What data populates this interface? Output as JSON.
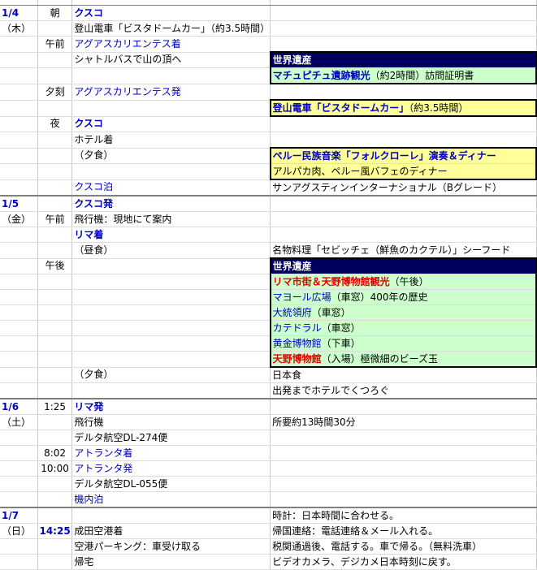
{
  "rows": [
    {
      "c0": "1/4",
      "c1": "朝",
      "c2": "クスコ",
      "c3": ""
    },
    {
      "c0": "（木）",
      "c1": "",
      "c2": "登山電車「ビスタドームカー」（約3.5時間）",
      "c3": ""
    },
    {
      "c0": "",
      "c1": "午前",
      "c2": "アグアスカリエンテス着",
      "c3": ""
    },
    {
      "c0": "",
      "c1": "",
      "c2": "シャトルバスで山の頂へ",
      "c3": "世界遺産"
    },
    {
      "c0": "",
      "c1": "",
      "c2": "",
      "c3a": "マチュピチュ遺跡観光",
      "c3b": "（約2時間）訪問証明書"
    },
    {
      "c0": "",
      "c1": "夕刻",
      "c2": "アグアスカリエンテス発",
      "c3": ""
    },
    {
      "c0": "",
      "c1": "",
      "c2": "",
      "c3a": "登山電車「ビスタドームカー」",
      "c3b": "（約3.5時間）"
    },
    {
      "c0": "",
      "c1": "夜",
      "c2": "クスコ",
      "c3": ""
    },
    {
      "c0": "",
      "c1": "",
      "c2": "ホテル着",
      "c3": ""
    },
    {
      "c0": "",
      "c1": "",
      "c2": "（夕食）",
      "c3": "ペルー民族音楽「フォルクローレ」演奏＆ディナー"
    },
    {
      "c0": "",
      "c1": "",
      "c2": "",
      "c3": "アルパカ肉、ペルー風バフェのディナー"
    },
    {
      "c0": "",
      "c1": "",
      "c2": "クスコ泊",
      "c3": "サンアグスティンインターナショナル（Bグレード）"
    },
    {
      "c0": "1/5",
      "c1": "",
      "c2": "クスコ発",
      "c3": ""
    },
    {
      "c0": "（金）",
      "c1": "午前",
      "c2": "飛行機：現地にて案内",
      "c3": ""
    },
    {
      "c0": "",
      "c1": "",
      "c2": "リマ着",
      "c3": ""
    },
    {
      "c0": "",
      "c1": "",
      "c2": "（昼食）",
      "c3": "名物料理「セビッチェ（鮮魚のカクテル）」シーフード"
    },
    {
      "c0": "",
      "c1": "午後",
      "c2": "",
      "c3": "世界遺産"
    },
    {
      "c0": "",
      "c1": "",
      "c2": "",
      "c3a": "リマ市街＆天野博物館観光",
      "c3b": "（午後）"
    },
    {
      "c0": "",
      "c1": "",
      "c2": "",
      "c3a": "マヨール広場",
      "c3b": "（車窓）400年の歴史"
    },
    {
      "c0": "",
      "c1": "",
      "c2": "",
      "c3a": "大統領府",
      "c3b": "（車窓）"
    },
    {
      "c0": "",
      "c1": "",
      "c2": "",
      "c3a": "カテドラル",
      "c3b": "（車窓）"
    },
    {
      "c0": "",
      "c1": "",
      "c2": "",
      "c3a": "黄金博物館",
      "c3b": "（下車）"
    },
    {
      "c0": "",
      "c1": "",
      "c2": "",
      "c3a": "天野博物館",
      "c3b": "（入場）極微細のビーズ玉"
    },
    {
      "c0": "",
      "c1": "",
      "c2": "（夕食）",
      "c3": "日本食"
    },
    {
      "c0": "",
      "c1": "",
      "c2": "",
      "c3": "出発までホテルでくつろぐ"
    },
    {
      "c0": "1/6",
      "c1": "1:25",
      "c2": "リマ発",
      "c3": ""
    },
    {
      "c0": "（土）",
      "c1": "",
      "c2": "飛行機",
      "c3": "所要約13時間30分"
    },
    {
      "c0": "",
      "c1": "",
      "c2": "デルタ航空DL-274便",
      "c3": ""
    },
    {
      "c0": "",
      "c1": "8:02",
      "c2": "アトランタ着",
      "c3": ""
    },
    {
      "c0": "",
      "c1": "10:00",
      "c2": "アトランタ発",
      "c3": ""
    },
    {
      "c0": "",
      "c1": "",
      "c2": "デルタ航空DL-055便",
      "c3": ""
    },
    {
      "c0": "",
      "c1": "",
      "c2": "機内泊",
      "c3": ""
    },
    {
      "c0": "1/7",
      "c1": "",
      "c2": "",
      "c3": "時計：日本時間に合わせる。"
    },
    {
      "c0": "（日）",
      "c1": "14:25",
      "c2": "成田空港着",
      "c3": "帰国連絡：電話連絡＆メール入れる。"
    },
    {
      "c0": "",
      "c1": "",
      "c2": "空港パーキング：車受け取る",
      "c3": "税関通過後、電話する。車で帰る。（無料洗車）"
    },
    {
      "c0": "",
      "c1": "",
      "c2": "帰宅",
      "c3": "ビデオカメラ、デジカメ日本時刻に戻す。"
    }
  ]
}
